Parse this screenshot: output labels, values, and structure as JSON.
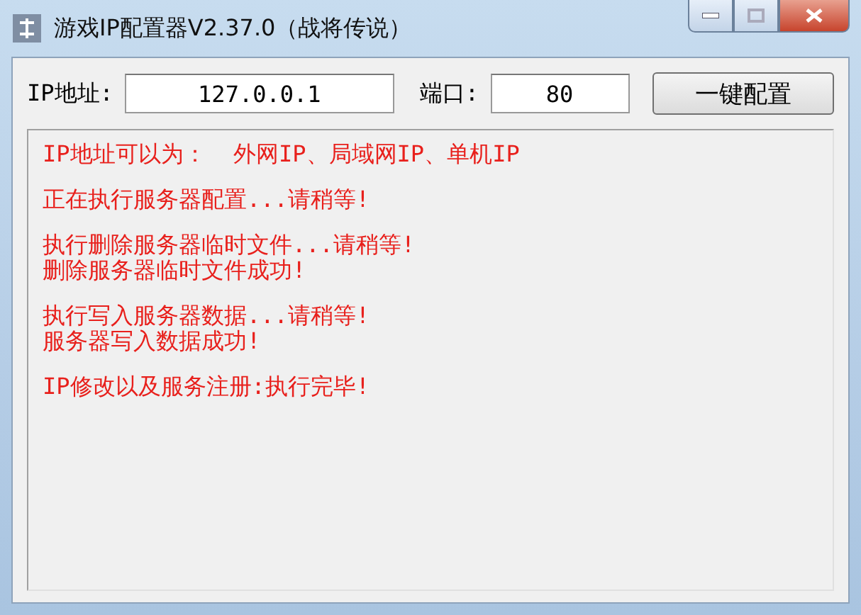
{
  "window": {
    "title": "游戏IP配置器V2.37.0（战将传说）"
  },
  "form": {
    "ip_label": "IP地址:",
    "ip_value": "127.0.0.1",
    "port_label": "端口:",
    "port_value": "80",
    "button": "一键配置"
  },
  "log": [
    {
      "lines": [
        "IP地址可以为：  外网IP、局域网IP、单机IP"
      ]
    },
    {
      "lines": [
        "正在执行服务器配置...请稍等!"
      ]
    },
    {
      "lines": [
        "执行删除服务器临时文件...请稍等!",
        "删除服务器临时文件成功!"
      ]
    },
    {
      "lines": [
        "执行写入服务器数据...请稍等!",
        "服务器写入数据成功!"
      ]
    },
    {
      "lines": [
        "IP修改以及服务注册:执行完毕!"
      ]
    }
  ]
}
